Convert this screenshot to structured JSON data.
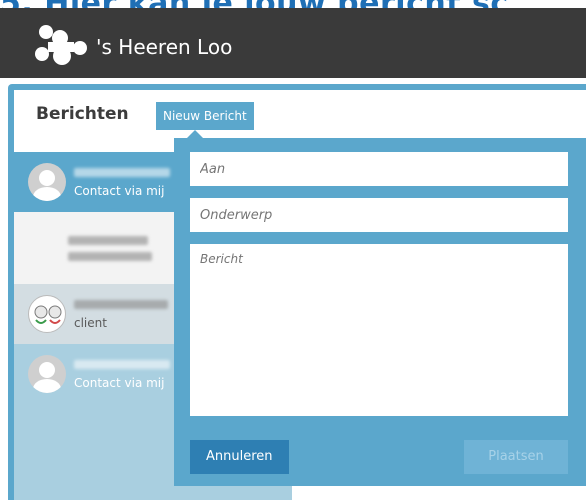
{
  "heading": {
    "text": "5. Hier kan je jouw bericht sc"
  },
  "header": {
    "brand": "'s Heeren Loo"
  },
  "page": {
    "title": "Berichten",
    "new_message_label": "Nieuw Bericht"
  },
  "conversations": [
    {
      "sub": "Contact via mij"
    },
    {
      "sub": ""
    },
    {
      "sub": "client"
    },
    {
      "sub": "Contact via mij"
    }
  ],
  "compose": {
    "to_placeholder": "Aan",
    "subject_placeholder": "Onderwerp",
    "body_placeholder": "Bericht",
    "cancel_label": "Annuleren",
    "post_label": "Plaatsen"
  },
  "colors": {
    "accent": "#5ba7cc",
    "header": "#3a3a3a",
    "heading": "#1f6fb5"
  }
}
